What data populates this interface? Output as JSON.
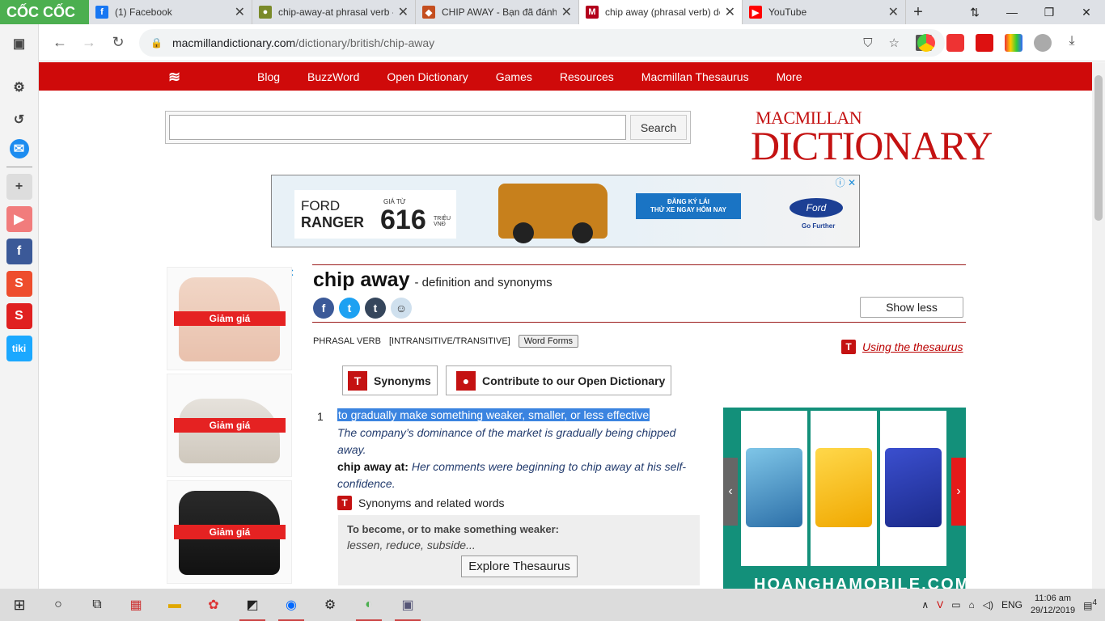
{
  "browser": {
    "brand": "CỐC CỐC",
    "tabs": [
      {
        "label": "(1) Facebook",
        "color": "#1877f2"
      },
      {
        "label": "chip-away-at phrasal verb - ",
        "color": "#7a8a2a"
      },
      {
        "label": "CHIP AWAY - Bạn đã đánh v",
        "color": "#c44e1f"
      },
      {
        "label": "chip away (phrasal verb) de",
        "color": "#b3001b"
      },
      {
        "label": "YouTube",
        "color": "#ff0000"
      }
    ],
    "url_host": "macmillandictionary.com",
    "url_path": "/dictionary/british/chip-away"
  },
  "site": {
    "nav": [
      "Blog",
      "BuzzWord",
      "Open Dictionary",
      "Games",
      "Resources",
      "Macmillan Thesaurus",
      "More"
    ],
    "search_button": "Search",
    "brand_line1": "MACMILLAN",
    "brand_line2": "DICTIONARY"
  },
  "banner": {
    "model_line1": "FORD",
    "model_line2": "RANGER",
    "price_label": "GIÁ TỪ",
    "price": "616",
    "price_unit": "TRIỆU VNĐ",
    "cta_line1": "ĐĂNG KÝ LÁI",
    "cta_line2": "THỬ XE NGAY HÔM NAY",
    "brand": "Ford",
    "slogan": "Go Further"
  },
  "left_ads": {
    "tag": "Giảm giá"
  },
  "entry": {
    "headword": "chip away",
    "subtitle": "- definition and synonyms",
    "show_less": "Show less",
    "pos": "PHRASAL VERB",
    "grammar": "[INTRANSITIVE/TRANSITIVE]",
    "word_forms": "Word Forms",
    "thesaurus_link": "Using the thesaurus",
    "synonyms_btn": "Synonyms",
    "contribute_btn": "Contribute to our Open Dictionary",
    "sense_number": "1",
    "definition": "to gradually make something weaker, smaller, or less effective",
    "example1": "The company’s dominance of the market is gradually being chipped away.",
    "pattern": "chip away at",
    "example2": "Her comments were beginning to chip away at his self-confidence.",
    "synonyms_heading": "Synonyms and related words",
    "thes_heading": "To become, or to make something weaker:",
    "thes_words": "lessen, reduce, subside...",
    "explore": "Explore Thesaurus"
  },
  "right_ad": {
    "brand_text": "HOANGHAMOBILE.COM"
  },
  "taskbar": {
    "lang": "ENG",
    "time": "11:06 am",
    "date": "29/12/2019",
    "notifications": "4"
  }
}
